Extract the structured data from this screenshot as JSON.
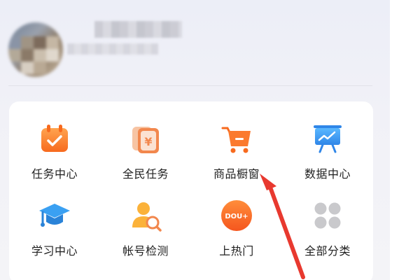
{
  "grid": {
    "items": [
      {
        "label": "任务中心",
        "icon": "task-calendar-icon"
      },
      {
        "label": "全民任务",
        "icon": "yuan-cards-icon"
      },
      {
        "label": "商品橱窗",
        "icon": "shopping-cart-icon"
      },
      {
        "label": "数据中心",
        "icon": "data-board-icon"
      },
      {
        "label": "学习中心",
        "icon": "graduation-cap-icon"
      },
      {
        "label": "帐号检测",
        "icon": "account-check-icon"
      },
      {
        "label": "上热门",
        "icon": "dou-plus-icon",
        "badge_text": "DOU+"
      },
      {
        "label": "全部分类",
        "icon": "all-categories-icon"
      }
    ]
  },
  "colors": {
    "orange": "#fb7a2e",
    "blue": "#3aa0f2",
    "arrow_red": "#e8392f"
  }
}
